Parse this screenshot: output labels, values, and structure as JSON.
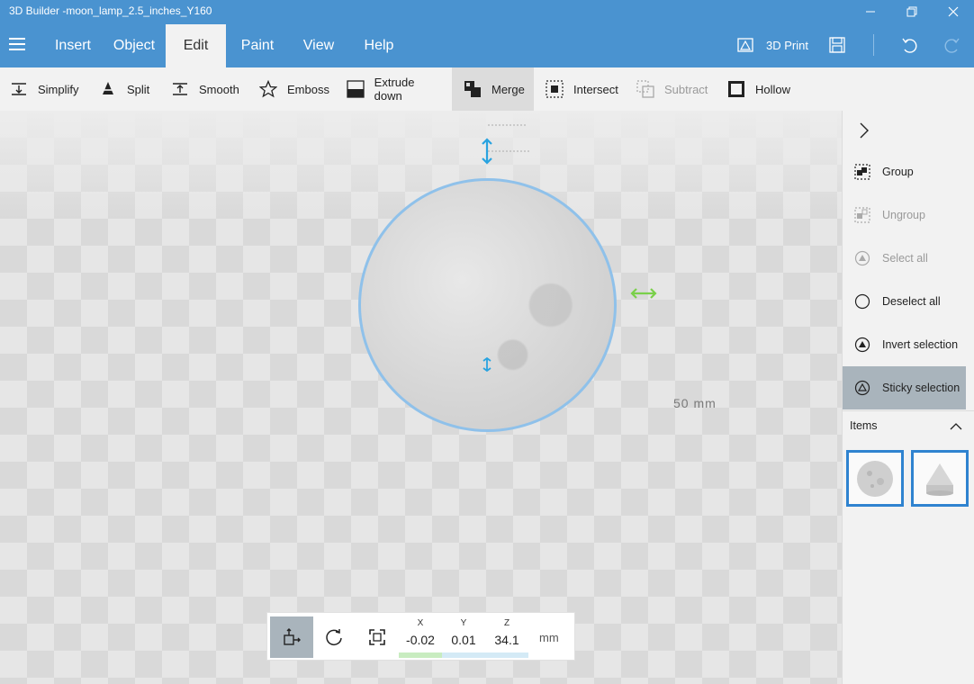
{
  "window": {
    "title": "3D Builder -moon_lamp_2.5_inches_Y160",
    "controls": [
      "minimize-icon",
      "restore-icon",
      "close-icon"
    ]
  },
  "ribbon": {
    "tabs": [
      {
        "label": "Insert"
      },
      {
        "label": "Object"
      },
      {
        "label": "Edit",
        "active": true
      },
      {
        "label": "Paint"
      },
      {
        "label": "View"
      },
      {
        "label": "Help"
      }
    ],
    "print_label": "3D Print",
    "accent": "#4a93d0"
  },
  "commands": [
    {
      "label": "Simplify",
      "icon": "simplify-icon"
    },
    {
      "label": "Split",
      "icon": "split-icon"
    },
    {
      "label": "Smooth",
      "icon": "smooth-icon"
    },
    {
      "label": "Emboss",
      "icon": "star-icon"
    },
    {
      "label": "Extrude down",
      "icon": "extrude-down-icon"
    },
    {
      "label": "Merge",
      "icon": "merge-icon",
      "active": true
    },
    {
      "label": "Intersect",
      "icon": "intersect-icon"
    },
    {
      "label": "Subtract",
      "icon": "subtract-icon",
      "disabled": true
    },
    {
      "label": "Hollow",
      "icon": "hollow-icon"
    }
  ],
  "viewport": {
    "scale_label": "50 mm",
    "selection_color": "#8fc1ea"
  },
  "transform": {
    "x": {
      "label": "X",
      "value": "-0.02",
      "color": "#c8ecc0"
    },
    "y": {
      "label": "Y",
      "value": "0.01",
      "color": "#d4eaf6"
    },
    "z": {
      "label": "Z",
      "value": "34.1",
      "color": "#d4eaf6"
    },
    "unit": "mm"
  },
  "side_panel": {
    "items": [
      {
        "label": "Group",
        "icon": "group-icon"
      },
      {
        "label": "Ungroup",
        "icon": "ungroup-icon",
        "disabled": true
      },
      {
        "label": "Select all",
        "icon": "select-all-icon",
        "disabled": true
      },
      {
        "label": "Deselect all",
        "icon": "deselect-all-icon"
      },
      {
        "label": "Invert selection",
        "icon": "invert-selection-icon"
      },
      {
        "label": "Sticky selection",
        "icon": "sticky-selection-icon",
        "active": true
      }
    ],
    "items_heading": "Items"
  }
}
